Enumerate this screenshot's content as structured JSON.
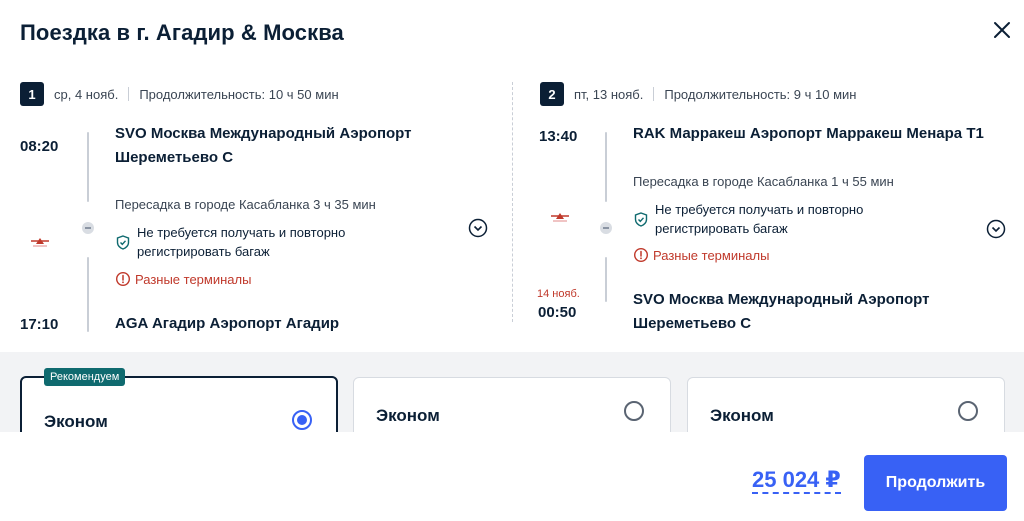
{
  "modal": {
    "title": "Поездка в г. Агадир & Москва"
  },
  "legs": [
    {
      "number": "1",
      "date": "ср, 4 нояб.",
      "duration": "Продолжительность: 10 ч 50 мин",
      "departure_time": "08:20",
      "departure_airport_line1": "SVO Москва Международный Аэропорт",
      "departure_airport_line2": "Шереметьево С",
      "transfer": "Пересадка в городе Касабланка  3 ч 35 мин",
      "baggage_notice_line1": "Не требуется получать и повторно",
      "baggage_notice_line2": "регистрировать багаж",
      "terminal_warning": "Разные терминалы",
      "arrival_time": "17:10",
      "arrival_airport_line1": "AGA Агадир Аэропорт Агадир"
    },
    {
      "number": "2",
      "date": "пт, 13 нояб.",
      "duration": "Продолжительность: 9 ч 10 мин",
      "departure_time": "13:40",
      "departure_airport_line1": "RAK Марракеш Аэропорт Марракеш Менара T1",
      "transfer": "Пересадка в городе Касабланка  1 ч 55 мин",
      "baggage_notice_line1": "Не требуется получать и повторно",
      "baggage_notice_line2": "регистрировать багаж",
      "terminal_warning": "Разные терминалы",
      "arrival_date": "14 нояб.",
      "arrival_time": "00:50",
      "arrival_airport_line1": "SVO Москва Международный Аэропорт",
      "arrival_airport_line2": "Шереметьево С"
    }
  ],
  "fares": [
    {
      "name": "Эконом",
      "badge": "Рекомендуем",
      "selected": true
    },
    {
      "name": "Эконом",
      "selected": false
    },
    {
      "name": "Эконом",
      "selected": false
    }
  ],
  "footer": {
    "price": "25 024 ₽",
    "continue_label": "Продолжить"
  },
  "colors": {
    "accent": "#3861f5",
    "dark": "#0b1f35",
    "warning": "#c0392b",
    "badge": "#0f6a6f"
  },
  "icons": [
    "close-icon",
    "chevron-down-icon",
    "shield-check-icon",
    "warning-icon",
    "airline-logo-icon"
  ]
}
